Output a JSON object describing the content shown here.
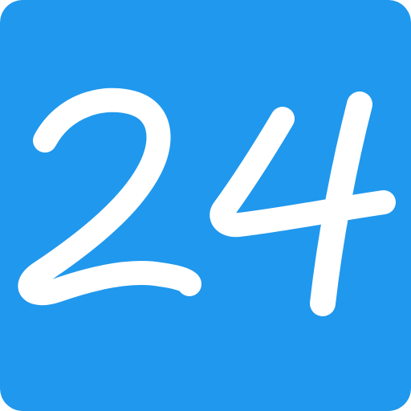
{
  "logo": {
    "text": "24",
    "background_color": "#2098ED",
    "foreground_color": "#FFFFFF"
  }
}
